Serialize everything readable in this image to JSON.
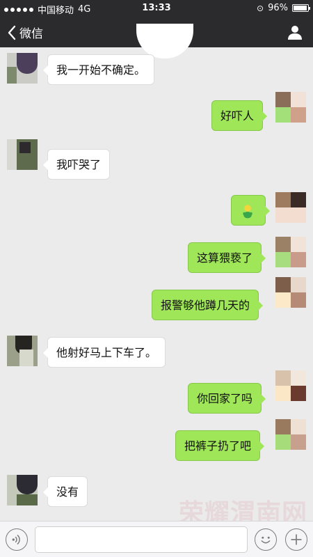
{
  "status_bar": {
    "carrier": "中国移动",
    "network": "4G",
    "time": "13:33",
    "battery_percent_label": "96%",
    "battery_level": 0.96
  },
  "nav": {
    "back_label": "微信"
  },
  "messages": [
    {
      "side": "left",
      "text": "我一开始不确定。"
    },
    {
      "side": "right",
      "text": "好吓人"
    },
    {
      "side": "left",
      "text": "我吓哭了"
    },
    {
      "side": "right",
      "sticker": "green-bean-sticker"
    },
    {
      "side": "right",
      "text": "这算猥亵了"
    },
    {
      "side": "right",
      "text": "报警够他蹲几天的"
    },
    {
      "side": "left",
      "text": "他射好马上下车了。"
    },
    {
      "side": "right",
      "text": "你回家了吗"
    },
    {
      "side": "right",
      "text": "把裤子扔了吧"
    },
    {
      "side": "left",
      "text": "没有"
    }
  ],
  "watermark": "荣耀渭南网",
  "input_bar": {
    "value": ""
  },
  "colors": {
    "nav_bg": "#2b2b2d",
    "chat_bg": "#ebebeb",
    "bubble_sent": "#9fe658",
    "bubble_received": "#ffffff"
  }
}
